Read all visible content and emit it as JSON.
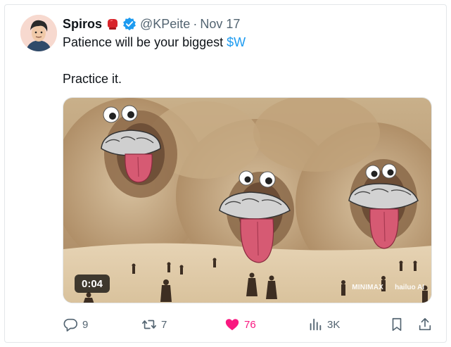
{
  "tweet": {
    "author_name": "Spiros",
    "handle": "@KPeite",
    "separator": "·",
    "date": "Nov 17",
    "line1_prefix": "Patience will be your biggest ",
    "cashtag": "$W",
    "line2": "Practice it."
  },
  "media": {
    "duration": "0:04",
    "watermark_minimax": "MINIMAX",
    "watermark_hailuo": "hailuo AI"
  },
  "actions": {
    "replies": "9",
    "retweets": "7",
    "likes": "76",
    "views": "3K"
  },
  "icons": {
    "emoji": "boxing-glove-icon",
    "verified": "verified-badge-icon",
    "reply": "reply-icon",
    "retweet": "retweet-icon",
    "like": "heart-icon",
    "views": "views-icon",
    "bookmark": "bookmark-icon",
    "share": "share-icon"
  },
  "colors": {
    "accent": "#1d9bf0",
    "like": "#f91880",
    "muted": "#536471",
    "text": "#0f1419"
  }
}
